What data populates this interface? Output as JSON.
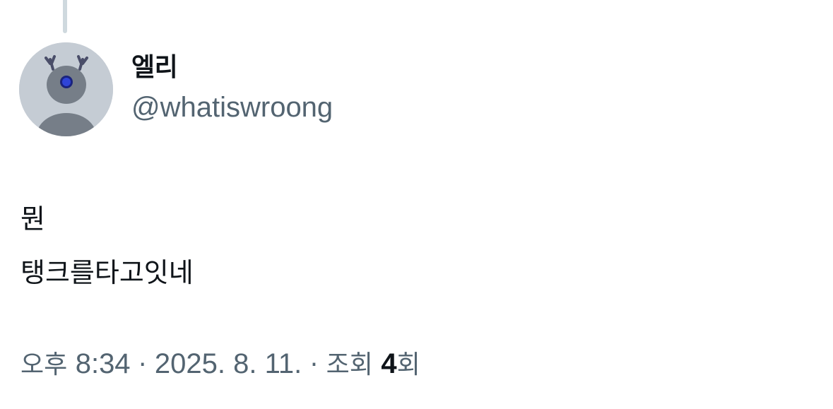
{
  "author": {
    "display_name": "엘리",
    "handle": "@whatiswroong",
    "avatar_icon": "gray-deer-avatar-icon"
  },
  "tweet": {
    "lines": [
      "뭔",
      "탱크를타고잇네"
    ]
  },
  "meta": {
    "ampm": "오후",
    "time": "8:34",
    "separator": "·",
    "date": "2025. 8. 11.",
    "views_label": "조회",
    "views_count": "4",
    "views_suffix": "회"
  },
  "colors": {
    "text_primary": "#0f1419",
    "text_secondary": "#536471",
    "thread_line": "#cfd9de",
    "avatar_bg": "#c5ccd4"
  }
}
